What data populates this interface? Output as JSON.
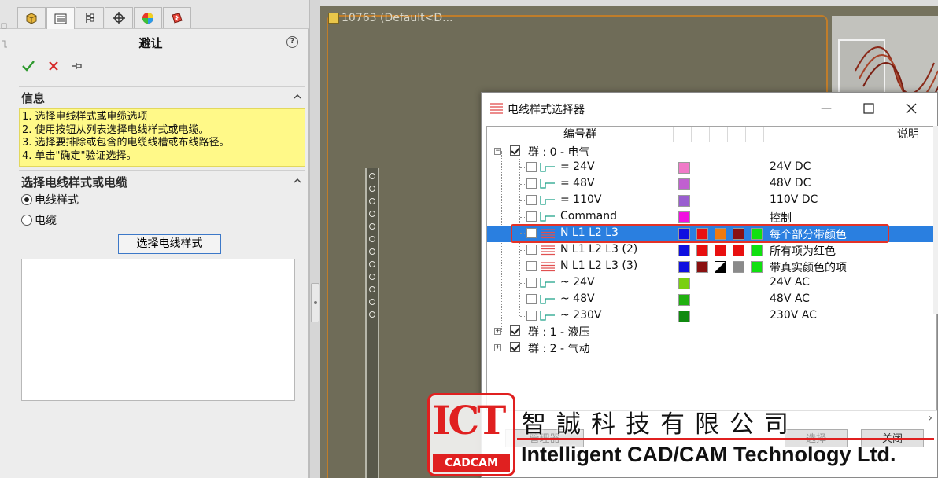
{
  "property_manager": {
    "title": "避让",
    "help": "?",
    "info_section": {
      "title": "信息",
      "lines": [
        "1. 选择电线样式或电缆选项",
        "2. 使用按钮从列表选择电线样式或电缆。",
        "3. 选择要排除或包含的电缆线槽或布线路径。",
        "4. 单击\"确定\"验证选择。"
      ]
    },
    "select_section": {
      "title": "选择电线样式或电缆",
      "option_wire_style": "电线样式",
      "option_cable": "电缆",
      "selected_option": "电线样式",
      "select_button": "选择电线样式"
    }
  },
  "graphics": {
    "root_label": "10763  (Default<D..."
  },
  "dialog": {
    "title": "电线样式选择器",
    "columns": {
      "number_group": "编号群",
      "description": "说明"
    },
    "groups": [
      {
        "label": "群 : 0 - 电气",
        "expanded": true,
        "checked": true,
        "items": [
          {
            "label": "=  24V",
            "colors": [
              "#f07ac8"
            ],
            "desc": "24V DC"
          },
          {
            "label": "=  48V",
            "colors": [
              "#c060d0"
            ],
            "desc": "48V DC"
          },
          {
            "label": "= 110V",
            "colors": [
              "#9a5ed0"
            ],
            "desc": "110V DC"
          },
          {
            "label": "Command",
            "colors": [
              "#f010e0"
            ],
            "desc": "控制"
          },
          {
            "label": "N L1 L2 L3",
            "colors": [
              "#1010e0",
              "#e81010",
              "#f07a10",
              "#8a1010",
              "#10e010"
            ],
            "desc": "每个部分带颜色",
            "selected": true
          },
          {
            "label": "N L1 L2 L3 (2)",
            "colors": [
              "#1010e0",
              "#e81010",
              "#e81010",
              "#e81010",
              "#10e010"
            ],
            "desc": "所有项为红色"
          },
          {
            "label": "N L1 L2 L3 (3)",
            "colors": [
              "#1010e0",
              "#8a1010",
              "#000000",
              "#8a8a8a",
              "#10e010"
            ],
            "desc": "带真实颜色的项"
          },
          {
            "label": "~  24V",
            "colors": [
              "#7ad010"
            ],
            "desc": "24V AC"
          },
          {
            "label": "~  48V",
            "colors": [
              "#20b010"
            ],
            "desc": "48V AC"
          },
          {
            "label": "~ 230V",
            "colors": [
              "#108a10"
            ],
            "desc": "230V AC"
          }
        ]
      },
      {
        "label": "群 : 1 - 液压",
        "expanded": false,
        "checked": true,
        "items": []
      },
      {
        "label": "群 : 2 - 气动",
        "expanded": false,
        "checked": true,
        "items": []
      }
    ],
    "buttons": {
      "manager": "管理器",
      "select": "选择",
      "close": "关闭"
    }
  },
  "watermark": {
    "logo": "ICT",
    "logo_sub": "CADCAM",
    "company_cn": "智誠科技有限公司",
    "company_en": "Intelligent CAD/CAM Technology Ltd."
  },
  "colors": {
    "selection": "#2a7fe0",
    "info_bg": "#fff988",
    "highlight": "#e53226",
    "watermark_red": "#e02020"
  }
}
